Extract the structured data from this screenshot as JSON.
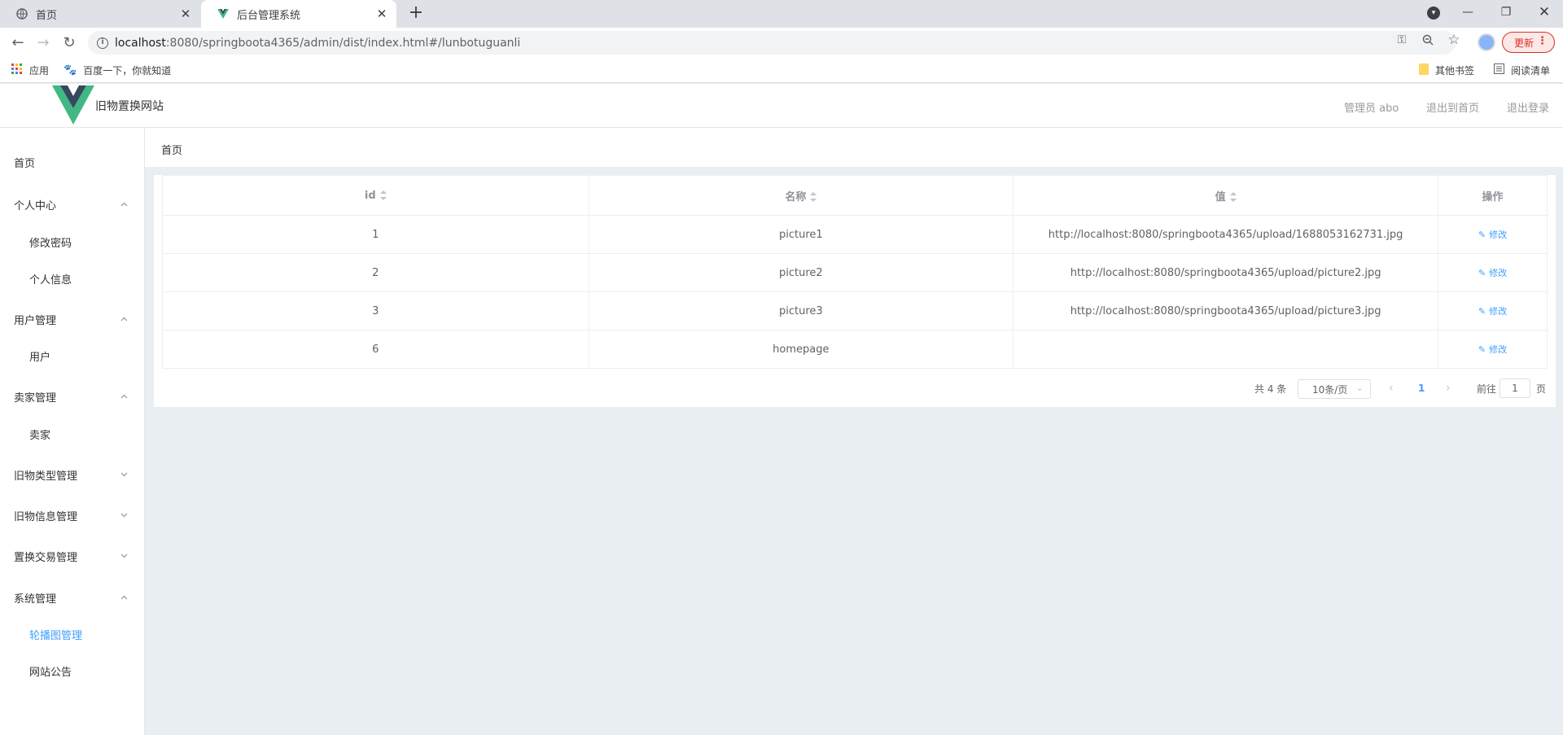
{
  "browser": {
    "tabs": [
      {
        "title": "首页",
        "icon": "globe-icon"
      },
      {
        "title": "后台管理系统",
        "icon": "vue-logo-icon"
      }
    ],
    "url_host": "localhost",
    "url_rest": ":8080/springboota4365/admin/dist/index.html#/lunbotuguanli",
    "update_label": "更新",
    "bookmarks": {
      "apps": "应用",
      "baidu": "百度一下，你就知道",
      "other": "其他书签",
      "reading": "阅读清单"
    }
  },
  "header": {
    "site_name": "旧物置换网站",
    "user": "管理员 abo",
    "back_home": "退出到首页",
    "logout": "退出登录"
  },
  "sidebar": {
    "items": [
      {
        "label": "首页",
        "type": "item"
      },
      {
        "label": "个人中心",
        "type": "group",
        "expanded": true
      },
      {
        "label": "修改密码",
        "type": "sub"
      },
      {
        "label": "个人信息",
        "type": "sub"
      },
      {
        "label": "用户管理",
        "type": "group",
        "expanded": true
      },
      {
        "label": "用户",
        "type": "sub"
      },
      {
        "label": "卖家管理",
        "type": "group",
        "expanded": true
      },
      {
        "label": "卖家",
        "type": "sub"
      },
      {
        "label": "旧物类型管理",
        "type": "group",
        "expanded": false
      },
      {
        "label": "旧物信息管理",
        "type": "group",
        "expanded": false
      },
      {
        "label": "置换交易管理",
        "type": "group",
        "expanded": false
      },
      {
        "label": "系统管理",
        "type": "group",
        "expanded": true
      },
      {
        "label": "轮播图管理",
        "type": "sub",
        "active": true
      },
      {
        "label": "网站公告",
        "type": "sub"
      }
    ]
  },
  "breadcrumb": "首页",
  "table": {
    "headers": [
      "id",
      "名称",
      "值",
      "操作"
    ],
    "edit_label": "修改",
    "rows": [
      {
        "id": "1",
        "name": "picture1",
        "value": "http://localhost:8080/springboota4365/upload/1688053162731.jpg"
      },
      {
        "id": "2",
        "name": "picture2",
        "value": "http://localhost:8080/springboota4365/upload/picture2.jpg"
      },
      {
        "id": "3",
        "name": "picture3",
        "value": "http://localhost:8080/springboota4365/upload/picture3.jpg"
      },
      {
        "id": "6",
        "name": "homepage",
        "value": ""
      }
    ]
  },
  "pagination": {
    "total": "共 4 条",
    "page_size": "10条/页",
    "current_page": "1",
    "goto_prefix": "前往",
    "goto_value": "1",
    "goto_suffix": "页"
  },
  "colors": {
    "accent": "#409eff",
    "sidebar_bg": "#ffffff",
    "content_bg": "#e9eef3",
    "vue_green": "#41b883",
    "vue_dark": "#35495e"
  }
}
